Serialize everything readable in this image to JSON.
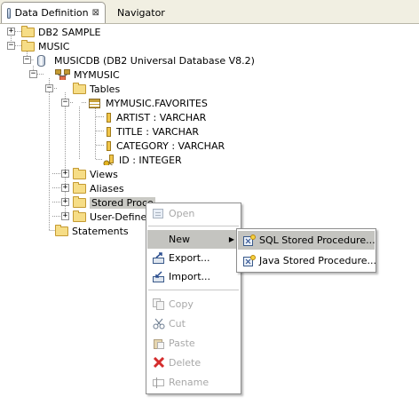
{
  "tabs": [
    {
      "label": "Data Definition",
      "close": "⊠",
      "active": true
    },
    {
      "label": "Navigator",
      "active": false
    }
  ],
  "tree": {
    "db2_sample": "DB2 SAMPLE",
    "music": "MUSIC",
    "musicdb": "MUSICDB (DB2 Universal Database V8.2)",
    "mymusic": "MYMUSIC",
    "tables": "Tables",
    "favorites": "MYMUSIC.FAVORITES",
    "columns": [
      "ARTIST : VARCHAR",
      "TITLE : VARCHAR",
      "CATEGORY : VARCHAR",
      "ID : INTEGER"
    ],
    "views": "Views",
    "aliases": "Aliases",
    "stored_procedures": "Stored Proce",
    "user_defined": "User-Defined",
    "statements": "Statements"
  },
  "context_menu": {
    "open": "Open",
    "new": "New",
    "export": "Export...",
    "import": "Import...",
    "copy": "Copy",
    "cut": "Cut",
    "paste": "Paste",
    "delete": "Delete",
    "rename": "Rename"
  },
  "submenu": {
    "sql": "SQL Stored Procedure...",
    "java": "Java Stored Procedure..."
  },
  "colors": {
    "tab_bar": "#f1efe2",
    "folder": "#f6dd86",
    "menu_hover": "#c4c4c0",
    "delete_icon": "#d42c2c"
  }
}
